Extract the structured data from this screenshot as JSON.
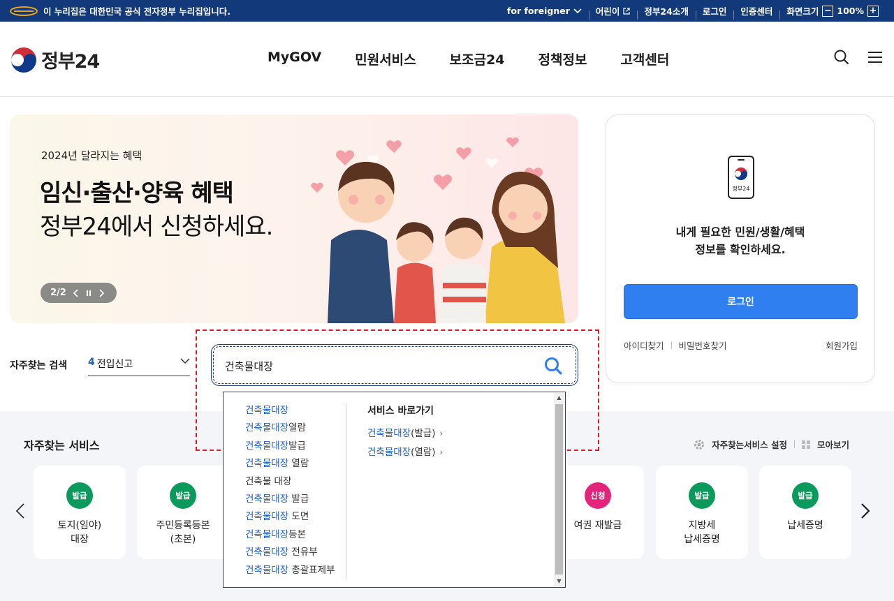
{
  "topbar": {
    "notice": "이 누리집은 대한민국 공식 전자정부 누리집입니다.",
    "links": [
      {
        "label": "for foreigner"
      },
      {
        "label": "어린이"
      },
      {
        "label": "정부24소개"
      },
      {
        "label": "로그인"
      },
      {
        "label": "인증센터"
      },
      {
        "label": "화면크기"
      }
    ],
    "zoom": "100%",
    "zoom_minus": "−",
    "zoom_plus": "+"
  },
  "header": {
    "logo_text": "정부24",
    "nav": [
      "MyGOV",
      "민원서비스",
      "보조금24",
      "정책정보",
      "고객센터"
    ]
  },
  "banner": {
    "subtitle": "2024년 달라지는 혜택",
    "title_line1": "임신·출산·양육 혜택",
    "title_line2": "정부24에서 신청하세요.",
    "pager": "2/2"
  },
  "login_card": {
    "app_label": "정부24",
    "message_line1": "내게 필요한 민원/생활/혜택",
    "message_line2": "정보를 확인하세요.",
    "login_button": "로그인",
    "find_id": "아이디찾기",
    "find_pw": "비밀번호찾기",
    "join": "회원가입"
  },
  "search": {
    "freq_label": "자주찾는 검색",
    "freq_rank": "4",
    "freq_value": "전입신고",
    "query": "건축물대장"
  },
  "autocomplete": {
    "suggestions": [
      {
        "hl": "건축물대장",
        "rest": ""
      },
      {
        "hl": "건축물대장",
        "rest": "열람"
      },
      {
        "hl": "건축물대장",
        "rest": "발급"
      },
      {
        "hl": "건축물대장",
        "rest": " 열람"
      },
      {
        "hl": "",
        "rest": "건축물 대장"
      },
      {
        "hl": "건축물대장",
        "rest": " 발급"
      },
      {
        "hl": "건축물대장",
        "rest": " 도면"
      },
      {
        "hl": "건축물대장",
        "rest": "등본"
      },
      {
        "hl": "건축물대장",
        "rest": " 전유부"
      },
      {
        "hl": "건축물대장",
        "rest": " 총괄표제부"
      }
    ],
    "shortcut_title": "서비스 바로가기",
    "shortcuts": [
      {
        "hl": "건축물대장",
        "rest": "(발급)",
        "arrow": "›"
      },
      {
        "hl": "건축물대장",
        "rest": "(열람)",
        "arrow": "›"
      }
    ]
  },
  "frequent_services": {
    "title": "자주찾는 서비스",
    "settings": "자주찾는서비스 설정",
    "view_all": "모아보기",
    "cards": [
      {
        "badge": "발급",
        "color": "#0b9a5b",
        "line1": "토지(임야)",
        "line2": "대장"
      },
      {
        "badge": "발급",
        "color": "#0b9a5b",
        "line1": "주민등록등본",
        "line2": "(초본)"
      },
      {
        "badge": "신청",
        "color": "#e3247a",
        "line1": "여권 재발급",
        "line2": ""
      },
      {
        "badge": "발급",
        "color": "#0b9a5b",
        "line1": "지방세",
        "line2": "납세증명"
      },
      {
        "badge": "발급",
        "color": "#0b9a5b",
        "line1": "납세증명",
        "line2": ""
      }
    ]
  },
  "colors": {
    "topbar_bg": "#123a7a",
    "primary_blue": "#2f7ff0",
    "highlight_blue": "#1f5fc7",
    "issue_green": "#0b9a5b",
    "apply_pink": "#e3247a",
    "annotation_red": "#e0192a"
  }
}
